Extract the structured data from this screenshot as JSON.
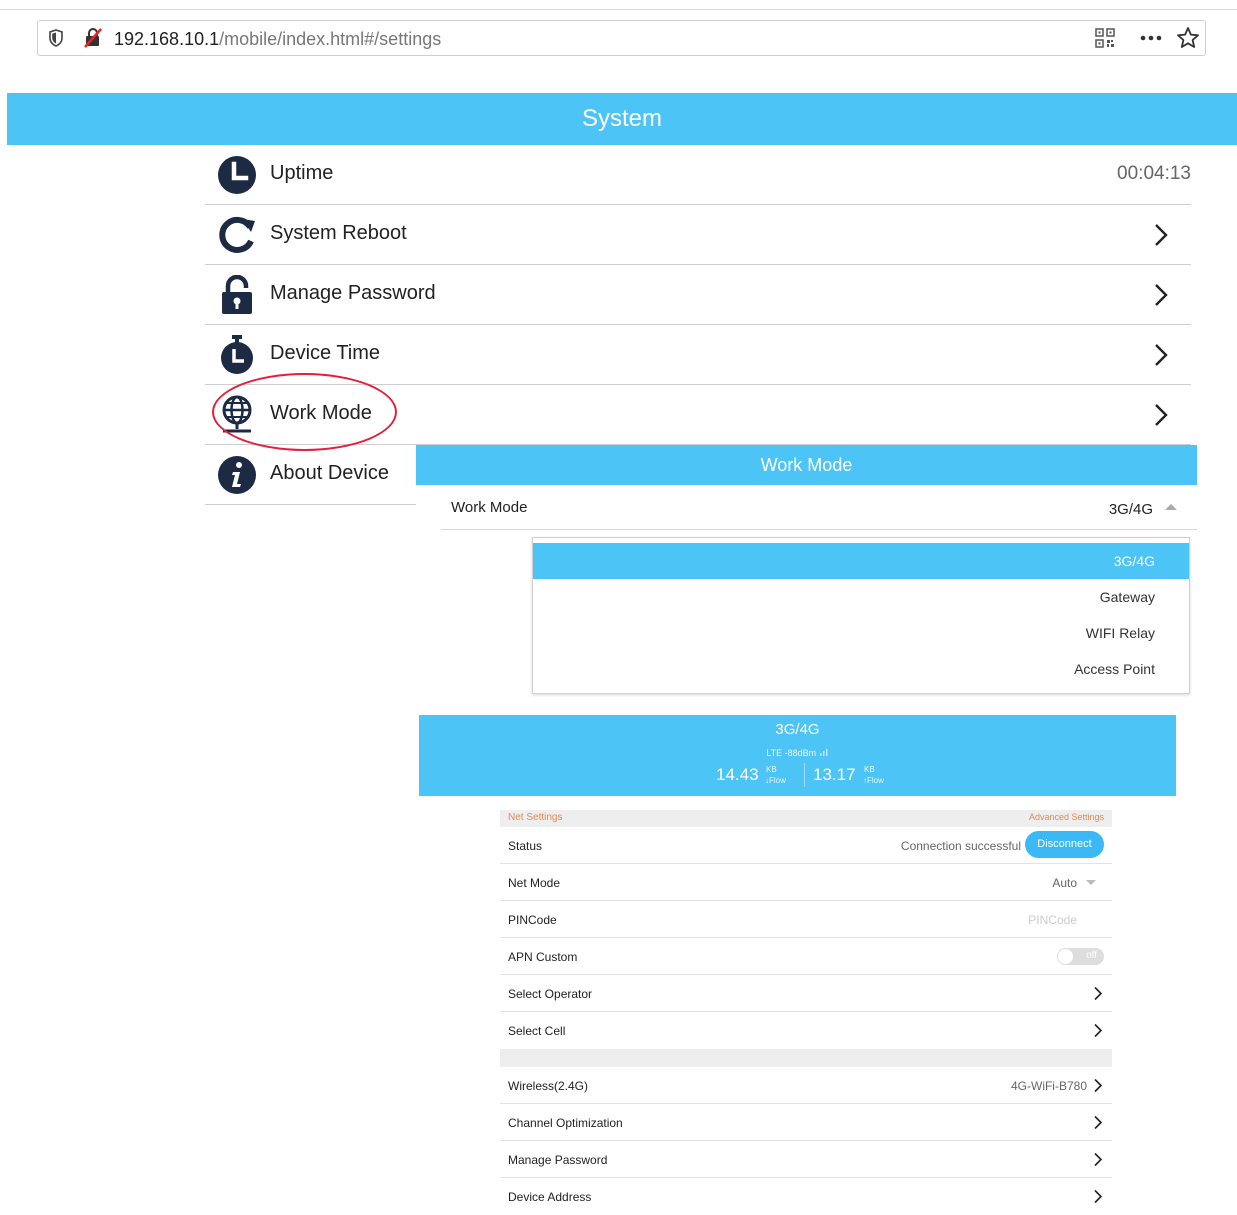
{
  "browser": {
    "url_host": "192.168.10.1",
    "url_path": "/mobile/index.html#/settings"
  },
  "system": {
    "title": "System",
    "items": [
      {
        "label": "Uptime",
        "value": "00:04:13"
      },
      {
        "label": "System Reboot"
      },
      {
        "label": "Manage Password"
      },
      {
        "label": "Device Time"
      },
      {
        "label": "Work Mode"
      },
      {
        "label": "About Device"
      }
    ]
  },
  "work_mode": {
    "title": "Work Mode",
    "row_label": "Work Mode",
    "row_value": "3G/4G",
    "options": [
      "3G/4G",
      "Gateway",
      "WIFI Relay",
      "Access Point"
    ],
    "selected": "3G/4G"
  },
  "band": {
    "mode": "3G/4G",
    "signal": "LTE  -88dBm",
    "down": "14.43",
    "down_unit": "KB",
    "down_label": "↓Flow",
    "up": "13.17",
    "up_unit": "KB",
    "up_label": "↑Flow"
  },
  "net": {
    "section": "Net Settings",
    "advanced": "Advanced Settings",
    "status_label": "Status",
    "status_value": "Connection successful",
    "disconnect": "Disconnect",
    "netmode_label": "Net Mode",
    "netmode_value": "Auto",
    "pin_label": "PINCode",
    "pin_placeholder": "PINCode",
    "apn_label": "APN Custom",
    "apn_toggle": "off",
    "operator_label": "Select Operator",
    "cell_label": "Select Cell",
    "wireless_label": "Wireless(2.4G)",
    "wireless_value": "4G-WiFi-B780",
    "channel_label": "Channel Optimization",
    "manage_pw_label": "Manage Password",
    "device_addr_label": "Device Address"
  },
  "colors": {
    "accent": "#4dc4f6",
    "button": "#3cb8f4",
    "highlight": "#e2203c",
    "section_text": "#e08a53"
  }
}
